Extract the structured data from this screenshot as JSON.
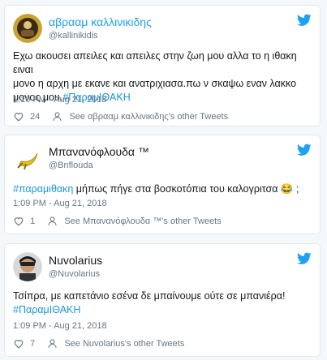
{
  "tweets": [
    {
      "name": "αβρααμ καλλινικιδης",
      "handle": "@kallinikidis",
      "text_lines": [
        "Εχω ακουσει απειλες και απειλες στην ζωη μου αλλα το η ιθακη ειναι",
        "μονο η αρχη με εκανε και ανατριχιασα.πω ν σκαψω εναν λακκο"
      ],
      "text_last_plain": "μονος μου.",
      "text_last_tag": "#ΠαραμΙΘΑΚΗ",
      "timestamp": "1:10 PM - Aug 21, 2018",
      "likes": "24",
      "see_other": "See αβρααμ καλλινικιδης's other Tweets"
    },
    {
      "name": "Μπανανόφλουδα ™",
      "handle": "@Bnflouda",
      "text_tag": "#παραμιθακη",
      "text_plain": " μήπως πήγε στα βοσκοτόπια του καλογριτσα 😂 ;",
      "timestamp": "1:09 PM - Aug 21, 2018",
      "likes": "1",
      "see_other": "See Μπανανόφλουδα ™'s other Tweets"
    },
    {
      "name": "Nuvolarius",
      "handle": "@Nuvolarius",
      "text_line1": "Τσίπρα, με καπετάνιο εσένα δε μπαίνουμε ούτε σε μπανιέρα!",
      "text_tag": "#ΠαραμΙΘΑΚΗ",
      "timestamp": "1:09 PM - Aug 21, 2018",
      "likes": "7",
      "see_other": "See Nuvolarius's other Tweets"
    }
  ],
  "colors": {
    "twitter_blue": "#1da1f2",
    "hashtag": "#1b95e0",
    "meta": "#657786"
  },
  "icons": [
    "twitter-bird-icon",
    "heart-icon",
    "person-icon"
  ]
}
